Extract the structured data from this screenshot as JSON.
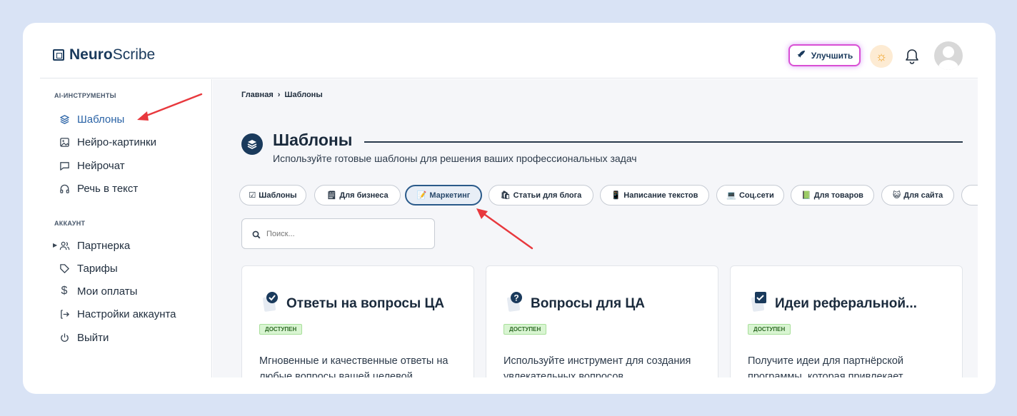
{
  "header": {
    "logo_bold": "Neuro",
    "logo_light": "Scribe",
    "upgrade_label": "Улучшить"
  },
  "sidebar": {
    "section1": "AI-ИНСТРУМЕНТЫ",
    "tools": [
      {
        "label": "Шаблоны",
        "icon": "layers-icon"
      },
      {
        "label": "Нейро-картинки",
        "icon": "image-icon"
      },
      {
        "label": "Нейрочат",
        "icon": "chat-icon"
      },
      {
        "label": "Речь в текст",
        "icon": "headphones-icon"
      }
    ],
    "section2": "АККАУНТ",
    "account": [
      {
        "label": "Партнерка",
        "icon": "users-icon"
      },
      {
        "label": "Тарифы",
        "icon": "tag-icon"
      },
      {
        "label": "Мои оплаты",
        "icon": "dollar-icon"
      },
      {
        "label": "Настройки аккаунта",
        "icon": "login-icon"
      },
      {
        "label": "Выйти",
        "icon": "power-icon"
      }
    ]
  },
  "breadcrumb": {
    "home": "Главная",
    "sep": "›",
    "current": "Шаблоны"
  },
  "page": {
    "title": "Шаблоны",
    "subtitle": "Используйте готовые шаблоны для решения ваших профессиональных задач"
  },
  "chips": [
    {
      "label": "Шаблоны",
      "icon": "☑"
    },
    {
      "label": "Для бизнеса",
      "icon": "🗒"
    },
    {
      "label": "Маркетинг",
      "icon": "📝"
    },
    {
      "label": "Статьи для блога",
      "icon": "🛍"
    },
    {
      "label": "Написание текстов",
      "icon": "📱"
    },
    {
      "label": "Соц.сети",
      "icon": "💻"
    },
    {
      "label": "Для товаров",
      "icon": "📗"
    },
    {
      "label": "Для сайта",
      "icon": "😺"
    }
  ],
  "search": {
    "placeholder": "Поиск..."
  },
  "cards": [
    {
      "title": "Ответы на вопросы ЦА",
      "badge": "ДОСТУПЕН",
      "desc": "Мгновенные и качественные ответы на любые вопросы вашей целевой",
      "icon": "check-circle-icon"
    },
    {
      "title": "Вопросы для ЦА",
      "badge": "ДОСТУПЕН",
      "desc": "Используйте инструмент для создания увлекательных вопросов",
      "icon": "question-circle-icon"
    },
    {
      "title": "Идеи реферальной...",
      "badge": "ДОСТУПЕН",
      "desc": "Получите идеи для партнёрской программы, которая привлекает",
      "icon": "checkbox-icon"
    }
  ],
  "colors": {
    "accent": "#2a63a6",
    "dark": "#1a3a5c",
    "arrow": "#e8383d"
  }
}
